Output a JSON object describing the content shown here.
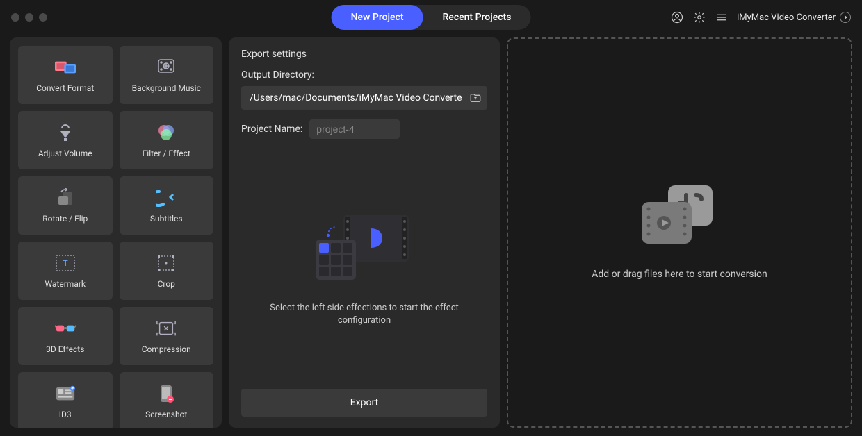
{
  "header": {
    "tabs": {
      "new": "New Project",
      "recent": "Recent Projects"
    },
    "app_title": "iMyMac Video Converter"
  },
  "sidebar": {
    "tools": [
      {
        "id": "convert-format",
        "label": "Convert Format",
        "icon": "convert-format-icon"
      },
      {
        "id": "background-music",
        "label": "Background Music",
        "icon": "music-icon"
      },
      {
        "id": "adjust-volume",
        "label": "Adjust Volume",
        "icon": "volume-icon"
      },
      {
        "id": "filter-effect",
        "label": "Filter / Effect",
        "icon": "filter-icon"
      },
      {
        "id": "rotate-flip",
        "label": "Rotate / Flip",
        "icon": "rotate-icon"
      },
      {
        "id": "subtitles",
        "label": "Subtitles",
        "icon": "subtitles-icon"
      },
      {
        "id": "watermark",
        "label": "Watermark",
        "icon": "watermark-icon"
      },
      {
        "id": "crop",
        "label": "Crop",
        "icon": "crop-icon"
      },
      {
        "id": "3d-effects",
        "label": "3D Effects",
        "icon": "glasses-icon"
      },
      {
        "id": "compression",
        "label": "Compression",
        "icon": "compression-icon"
      },
      {
        "id": "id3",
        "label": "ID3",
        "icon": "id3-icon"
      },
      {
        "id": "screenshot",
        "label": "Screenshot",
        "icon": "screenshot-icon"
      }
    ]
  },
  "export": {
    "heading": "Export settings",
    "dir_label": "Output Directory:",
    "dir_value": "/Users/mac/Documents/iMyMac Video Converte",
    "name_label": "Project Name:",
    "name_placeholder": "project-4",
    "hint": "Select the left side effections to start the effect configuration",
    "button": "Export"
  },
  "dropzone": {
    "text": "Add or drag files here to start conversion"
  }
}
